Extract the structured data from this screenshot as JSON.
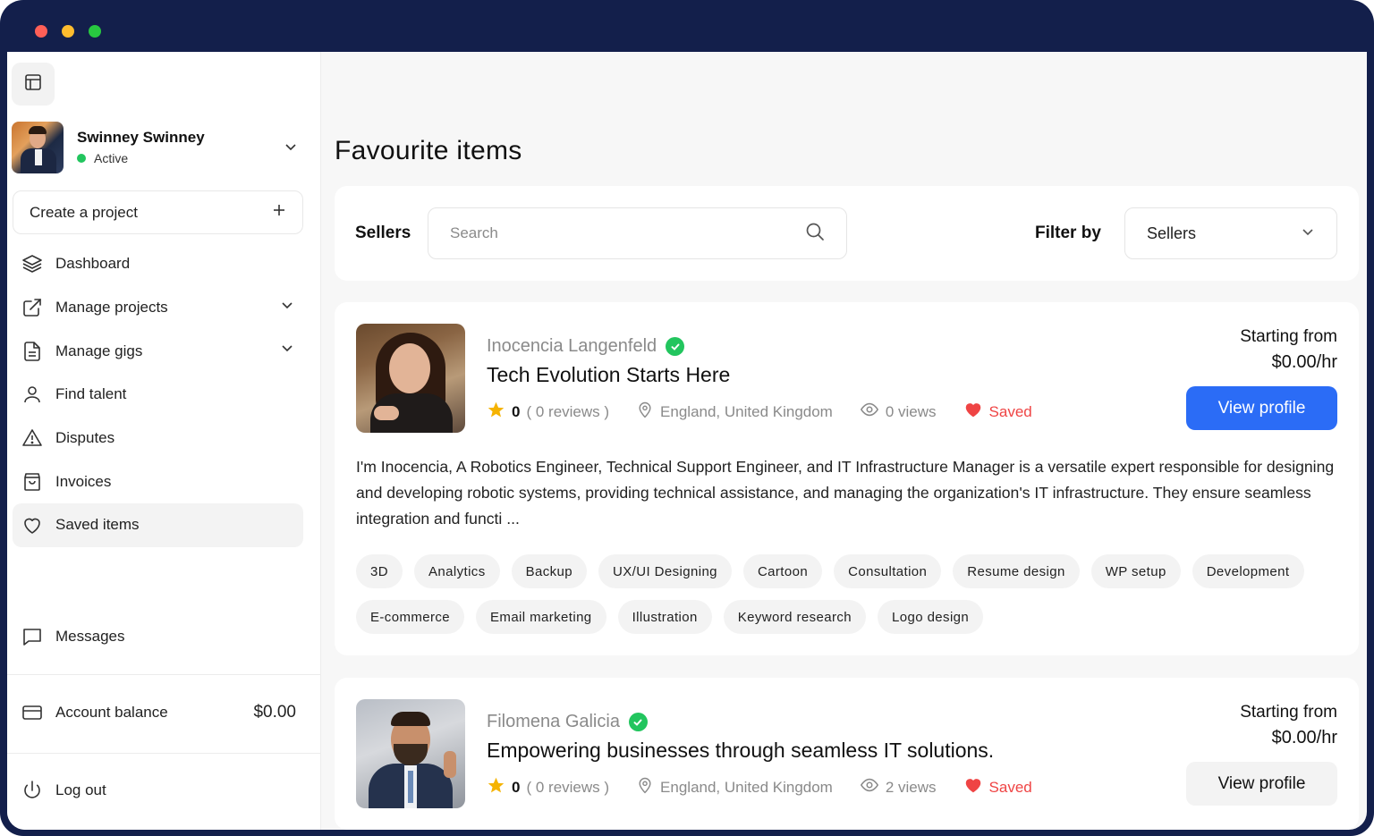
{
  "window": {
    "traffic_lights": [
      "close",
      "minimize",
      "maximize"
    ]
  },
  "sidebar": {
    "user": {
      "name": "Swinney Swinney",
      "status": "Active"
    },
    "create_project": "Create a project",
    "items": [
      {
        "label": "Dashboard",
        "icon": "layers-icon",
        "has_chevron": false
      },
      {
        "label": "Manage projects",
        "icon": "external-link-icon",
        "has_chevron": true
      },
      {
        "label": "Manage gigs",
        "icon": "document-icon",
        "has_chevron": true
      },
      {
        "label": "Find talent",
        "icon": "user-icon",
        "has_chevron": false
      },
      {
        "label": "Disputes",
        "icon": "alert-triangle-icon",
        "has_chevron": false
      },
      {
        "label": "Invoices",
        "icon": "shopping-bag-icon",
        "has_chevron": false
      },
      {
        "label": "Saved items",
        "icon": "heart-icon",
        "has_chevron": false,
        "active": true
      }
    ],
    "messages": "Messages",
    "account_balance": {
      "label": "Account balance",
      "amount": "$0.00"
    },
    "logout": "Log out"
  },
  "main": {
    "title": "Favourite items",
    "filter": {
      "sellers_label": "Sellers",
      "search_placeholder": "Search",
      "filter_by_label": "Filter by",
      "filter_value": "Sellers"
    },
    "sellers": [
      {
        "name": "Inocencia Langenfeld",
        "verified": true,
        "tagline": "Tech Evolution Starts Here",
        "rating": "0",
        "reviews": "( 0 reviews )",
        "location": "England, United Kingdom",
        "views": "0 views",
        "saved": "Saved",
        "price_label": "Starting from",
        "price": "$0.00/hr",
        "button": "View profile",
        "description": "I'm Inocencia, A Robotics Engineer, Technical Support Engineer, and IT Infrastructure Manager is a versatile expert responsible for designing and developing robotic systems, providing technical assistance, and managing the organization's IT infrastructure. They ensure seamless integration and functi ...",
        "tags": [
          "3D",
          "Analytics",
          "Backup",
          "UX/UI Designing",
          "Cartoon",
          "Consultation",
          "Resume design",
          "WP setup",
          "Development",
          "E-commerce",
          "Email marketing",
          "Illustration",
          "Keyword research",
          "Logo design"
        ]
      },
      {
        "name": "Filomena Galicia",
        "verified": true,
        "tagline": "Empowering businesses through seamless IT solutions.",
        "rating": "0",
        "reviews": "( 0 reviews )",
        "location": "England, United Kingdom",
        "views": "2 views",
        "saved": "Saved",
        "price_label": "Starting from",
        "price": "$0.00/hr",
        "button": "View profile"
      }
    ]
  },
  "colors": {
    "frame": "#131f4b",
    "primary": "#2b6cf6",
    "verified": "#22c55e",
    "saved": "#ef4444",
    "star": "#f5b301"
  }
}
